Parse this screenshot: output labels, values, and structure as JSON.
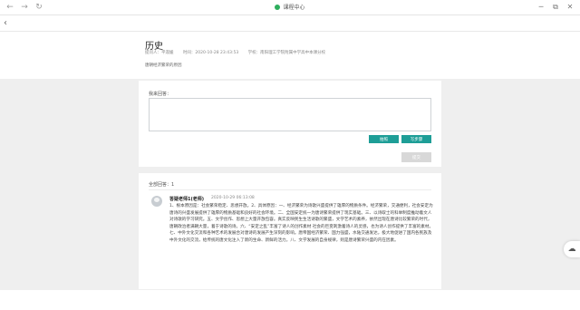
{
  "titlebar": {
    "title": "课程中心",
    "back_icon": "←",
    "forward_icon": "→",
    "reload_icon": "↻",
    "restore_icon": "⧉",
    "minimize_icon": "─",
    "close_icon": "✕",
    "accent": "#2eae5d"
  },
  "subbar": {
    "back_icon": "‹"
  },
  "header": {
    "title": "历史",
    "meta": [
      "提问人：平淑媛",
      "时间：2020-10-28  23:43:53",
      "学校：南阳理工学院附属中学高中本课分校"
    ],
    "description": "唐朝经济繁荣的原因"
  },
  "reply": {
    "label": "我来回答：",
    "placeholder": "",
    "btn1": "拍照",
    "btn2": "写步骤",
    "submit": "提交",
    "btn_color": "#1e9e97"
  },
  "answers": {
    "count_label": "全部回答：1",
    "items": [
      {
        "author": "答疑老师1(老师)",
        "time": "2020-10-29  06:13:08",
        "body": "1、根本原因是：社会繁荣稳定、思想开放。2、具体原因：一、经济繁荣为诗歌兴盛提供了雄厚的物质条件。经济繁荣，交通便利，社会安定为唐诗的兴盛发展提供了雄厚的物质基础和良好的社会环境。二、全国安定统一为唐诗繁荣提供了现实基础。三、以诗取士的科举制度推动着文人对诗歌的学习研究。五、文学创作、思想上大量开放包容。真实反映民生生活诗歌的繁盛，文学艺术的素养，依然出现在唐诗比较繁荣的时代，唐朝政治者满朝大量，着于诗歌的诗。六、“安定之乱”丰富了诗人的创作素材 社会的巨变刺激着诗人的灵感，也为诗人创作提供了丰富的素材。七、中外文化交流和各种艺术的发展合对唐诗的发展产生深刻的影响。唐帝国经济繁荣、国力强盛，水陆交通发达，极大地促进了国内各民族及中外文化的交流，给传统的唐文化注入了新的生命、新鲜的活力。八、文学发展的自身规律，则是唐诗繁荣兴盛的内在因素。"
      }
    ]
  },
  "floating": {
    "cloud_icon": "☁"
  }
}
